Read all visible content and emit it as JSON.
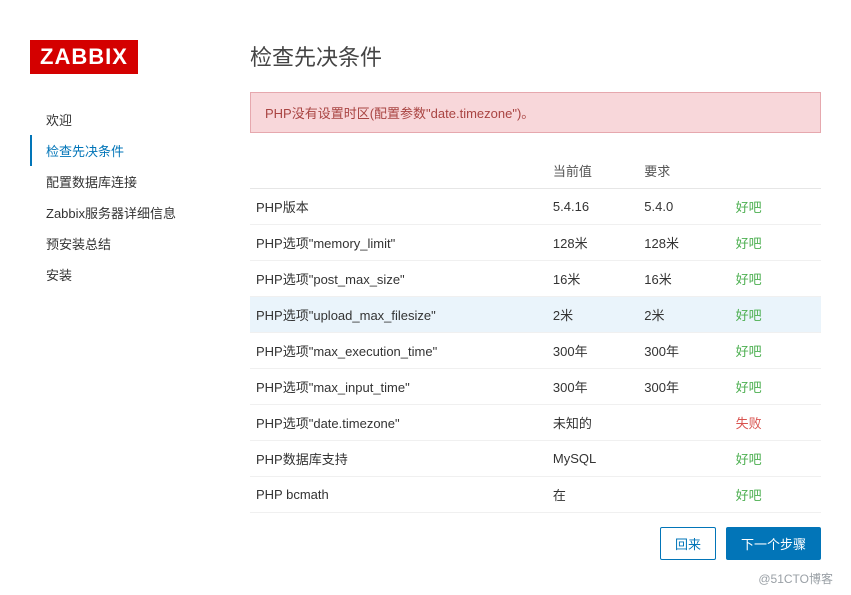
{
  "logo": "ZABBIX",
  "sidebar": {
    "items": [
      {
        "label": "欢迎",
        "active": false
      },
      {
        "label": "检查先决条件",
        "active": true
      },
      {
        "label": "配置数据库连接",
        "active": false
      },
      {
        "label": "Zabbix服务器详细信息",
        "active": false
      },
      {
        "label": "预安装总结",
        "active": false
      },
      {
        "label": "安装",
        "active": false
      }
    ]
  },
  "main": {
    "title": "检查先决条件",
    "alert": "PHP没有设置时区(配置参数\"date.timezone\")。",
    "headers": {
      "name": "",
      "current": "当前值",
      "required": "要求",
      "status": ""
    },
    "rows": [
      {
        "name": "PHP版本",
        "current": "5.4.16",
        "required": "5.4.0",
        "status": "好吧",
        "ok": true
      },
      {
        "name": "PHP选项\"memory_limit\"",
        "current": "128米",
        "required": "128米",
        "status": "好吧",
        "ok": true
      },
      {
        "name": "PHP选项\"post_max_size\"",
        "current": "16米",
        "required": "16米",
        "status": "好吧",
        "ok": true
      },
      {
        "name": "PHP选项\"upload_max_filesize\"",
        "current": "2米",
        "required": "2米",
        "status": "好吧",
        "ok": true,
        "hover": true
      },
      {
        "name": "PHP选项\"max_execution_time\"",
        "current": "300年",
        "required": "300年",
        "status": "好吧",
        "ok": true
      },
      {
        "name": "PHP选项\"max_input_time\"",
        "current": "300年",
        "required": "300年",
        "status": "好吧",
        "ok": true
      },
      {
        "name": "PHP选项\"date.timezone\"",
        "current": "未知的",
        "required": "",
        "status": "失败",
        "ok": false
      },
      {
        "name": "PHP数据库支持",
        "current": "MySQL",
        "required": "",
        "status": "好吧",
        "ok": true
      },
      {
        "name": "PHP bcmath",
        "current": "在",
        "required": "",
        "status": "好吧",
        "ok": true
      }
    ]
  },
  "footer": {
    "back": "回来",
    "next": "下一个步骤"
  },
  "watermark": "@51CTO博客"
}
